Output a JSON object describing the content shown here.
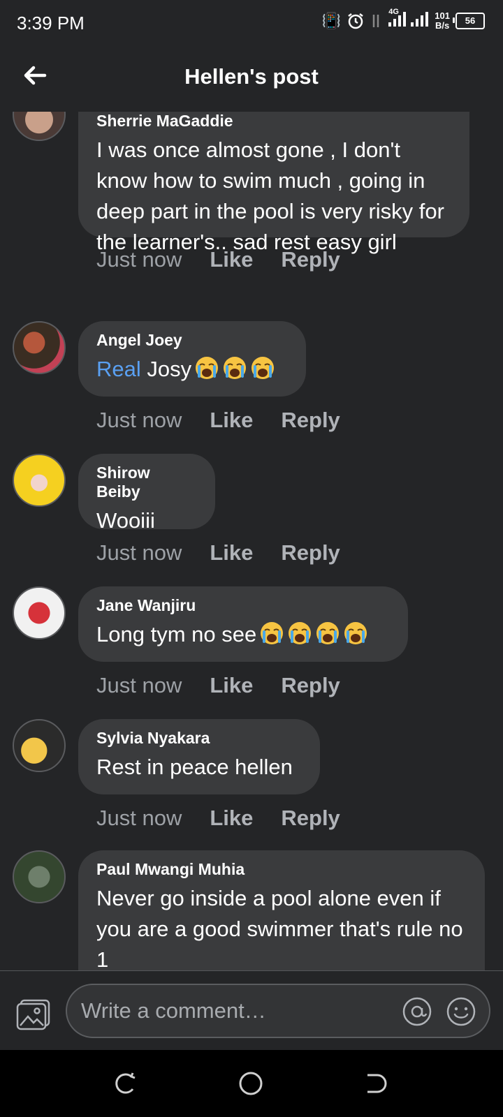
{
  "status_bar": {
    "time": "3:39 PM",
    "network": "4G",
    "speed_value": "101",
    "speed_unit": "B/s",
    "battery": "56"
  },
  "header": {
    "title": "Hellen's post"
  },
  "comments": [
    {
      "author": "Sherrie MaGaddie",
      "text": "I was once almost gone , I don't know how to swim much , going in deep part in the pool is very risky for the learner's.. sad rest easy girl",
      "time": "Just now",
      "like": "Like",
      "reply": "Reply"
    },
    {
      "author": "Angel Joey",
      "mention": "Real",
      "text": " Josy",
      "emojis": [
        "crying-face",
        "crying-face",
        "crying-face"
      ],
      "time": "Just now",
      "like": "Like",
      "reply": "Reply"
    },
    {
      "author": "Shirow Beiby",
      "text": "Wooiii",
      "time": "Just now",
      "like": "Like",
      "reply": "Reply"
    },
    {
      "author": "Jane Wanjiru",
      "text": "Long tym no see",
      "emojis": [
        "crying-face",
        "crying-face",
        "crying-face",
        "crying-face"
      ],
      "time": "Just now",
      "like": "Like",
      "reply": "Reply"
    },
    {
      "author": "Sylvia Nyakara",
      "text": "Rest in peace hellen",
      "time": "Just now",
      "like": "Like",
      "reply": "Reply"
    },
    {
      "author": "Paul Mwangi Muhia",
      "text": "Never go inside a pool alone even if you are a good swimmer that's rule no 1"
    }
  ],
  "composer": {
    "placeholder": "Write a comment…"
  },
  "colors": {
    "background": "#242527",
    "bubble": "#3a3b3d",
    "mention": "#5aa0f2",
    "action": "#b0b3b8"
  }
}
